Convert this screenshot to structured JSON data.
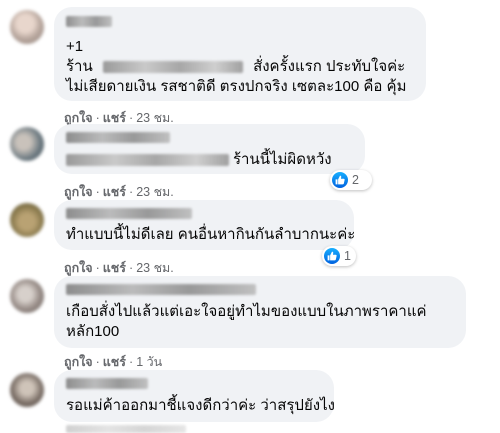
{
  "comments": [
    {
      "line1": "+1",
      "line2_prefix": "ร้าน",
      "line2_suffix": "สั่งครั้งแรก ประทับใจค่ะ",
      "line3": "ไม่เสียดายเงิน รสชาติดี ตรงปกจริง เซตละ100 คือ คุ้ม",
      "like": "ถูกใจ",
      "reply": "แชร์",
      "time": "23 ชม."
    },
    {
      "text": "ร้านนี้ไม่ผิดหวัง",
      "like": "ถูกใจ",
      "reply": "แชร์",
      "time": "23 ชม.",
      "reaction_icon": "like-icon",
      "reaction_count": "2"
    },
    {
      "text": "ทำแบบนี้ไม่ดีเลย คนอื่นหากินกันลำบากนะค่ะ",
      "like": "ถูกใจ",
      "reply": "แชร์",
      "time": "23 ชม.",
      "reaction_icon": "like-icon",
      "reaction_count": "1"
    },
    {
      "line1": "เกือบสั่งไปแล้วแต่เอะใจอยู่ทำไมของแบบในภาพราคาแค่",
      "line2": "หลัก100",
      "like": "ถูกใจ",
      "reply": "แชร์",
      "time": "1 วัน"
    },
    {
      "text": "รอแม่ค้าออกมาชี้แจงดีกว่าค่ะ ว่าสรุปยังไง"
    }
  ],
  "colors": {
    "bubble": "#f0f2f5",
    "meta_text": "#65676b",
    "like_blue": "#1877f2"
  }
}
